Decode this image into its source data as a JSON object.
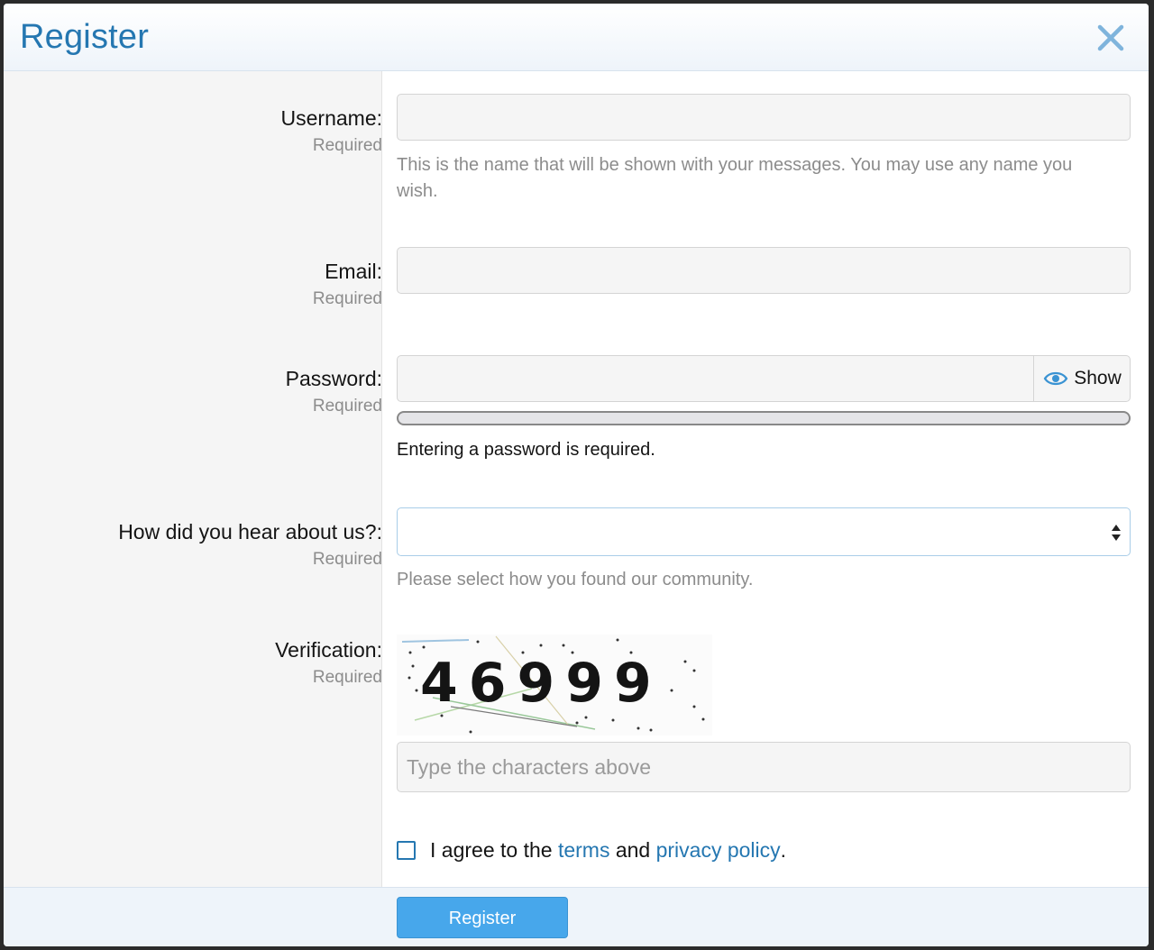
{
  "dialog": {
    "title": "Register"
  },
  "fields": {
    "username": {
      "label": "Username:",
      "required": "Required",
      "value": "",
      "hint": "This is the name that will be shown with your messages. You may use any name you wish."
    },
    "email": {
      "label": "Email:",
      "required": "Required",
      "value": ""
    },
    "password": {
      "label": "Password:",
      "required": "Required",
      "value": "",
      "show_label": "Show",
      "strength": 0,
      "message": "Entering a password is required."
    },
    "source": {
      "label": "How did you hear about us?:",
      "required": "Required",
      "selected": "",
      "hint": "Please select how you found our community."
    },
    "verification": {
      "label": "Verification:",
      "required": "Required",
      "captcha_text": "46999",
      "placeholder": "Type the characters above",
      "value": ""
    }
  },
  "agreement": {
    "prefix": "I agree to the",
    "terms_link": "terms",
    "and": "and",
    "privacy_link": "privacy policy",
    "suffix": ".",
    "checked": false
  },
  "footer": {
    "submit_label": "Register"
  },
  "colors": {
    "accent": "#2577b1",
    "button": "#47a7eb"
  },
  "icons": {
    "close": "close-icon",
    "show_password": "eye-icon",
    "select": "select-arrows-icon"
  }
}
